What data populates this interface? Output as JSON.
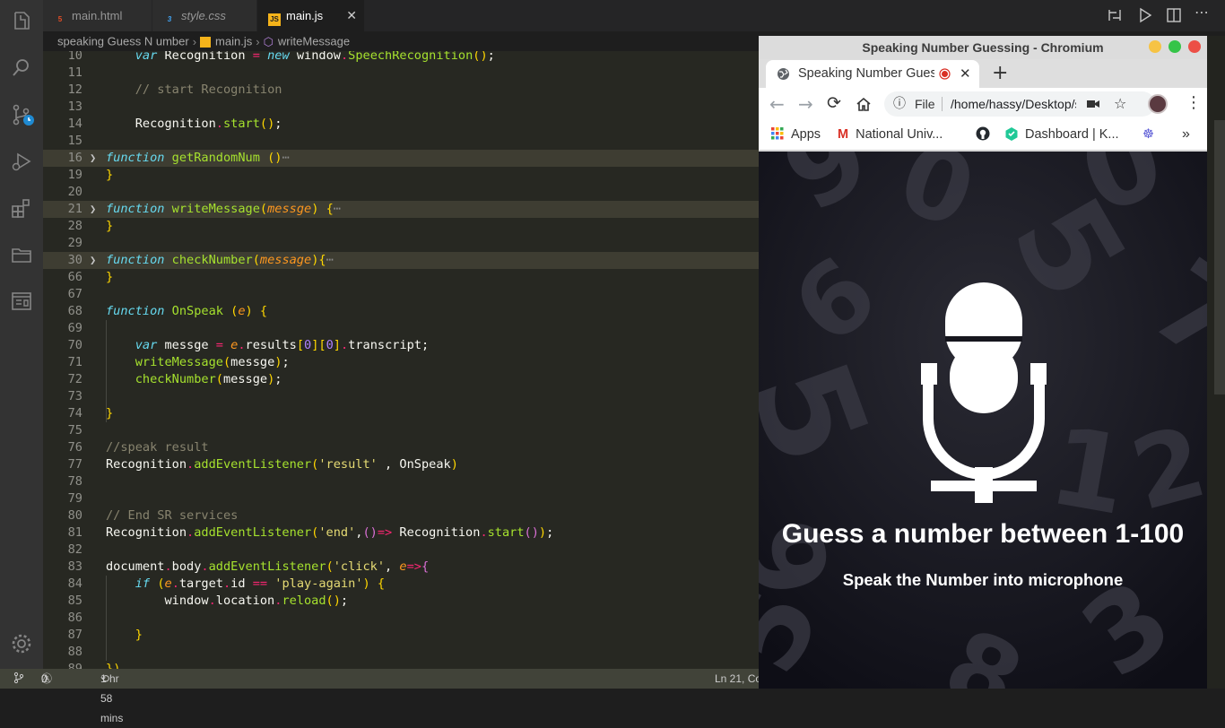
{
  "editor_tabs": [
    {
      "name": "main.html",
      "icon": "html5-icon",
      "active": false
    },
    {
      "name": "style.css",
      "icon": "css3-icon",
      "active": false
    },
    {
      "name": "main.js",
      "icon": "js-file-icon",
      "active": true
    }
  ],
  "breadcrumb": {
    "folder": "speaking Guess N umber",
    "file": "main.js",
    "symbol": "writeMessage"
  },
  "code_lines": [
    {
      "n": "10",
      "src": "    var Recognition = new window.SpeechRecognition();"
    },
    {
      "n": "11",
      "src": ""
    },
    {
      "n": "12",
      "src": "    // start Recognition"
    },
    {
      "n": "13",
      "src": ""
    },
    {
      "n": "14",
      "src": "    Recognition.start();"
    },
    {
      "n": "15",
      "src": ""
    },
    {
      "n": "16",
      "src": "function getRandomNum ()⋯",
      "folded": true
    },
    {
      "n": "19",
      "src": "}"
    },
    {
      "n": "20",
      "src": ""
    },
    {
      "n": "21",
      "src": "function writeMessage(messge) {⋯",
      "folded": true
    },
    {
      "n": "28",
      "src": "}"
    },
    {
      "n": "29",
      "src": ""
    },
    {
      "n": "30",
      "src": "function checkNumber(message){⋯",
      "folded": true
    },
    {
      "n": "66",
      "src": "}"
    },
    {
      "n": "67",
      "src": ""
    },
    {
      "n": "68",
      "src": "function OnSpeak (e) {"
    },
    {
      "n": "69",
      "src": ""
    },
    {
      "n": "70",
      "src": "    var messge = e.results[0][0].transcript;"
    },
    {
      "n": "71",
      "src": "    writeMessage(messge);"
    },
    {
      "n": "72",
      "src": "    checkNumber(messge);"
    },
    {
      "n": "73",
      "src": ""
    },
    {
      "n": "74",
      "src": "}"
    },
    {
      "n": "75",
      "src": ""
    },
    {
      "n": "76",
      "src": "//speak result"
    },
    {
      "n": "77",
      "src": "Recognition.addEventListener('result' , OnSpeak)"
    },
    {
      "n": "78",
      "src": ""
    },
    {
      "n": "79",
      "src": ""
    },
    {
      "n": "80",
      "src": "// End SR services"
    },
    {
      "n": "81",
      "src": "Recognition.addEventListener('end',()=> Recognition.start());"
    },
    {
      "n": "82",
      "src": ""
    },
    {
      "n": "83",
      "src": "document.body.addEventListener('click', e=>{"
    },
    {
      "n": "84",
      "src": "    if (e.target.id == 'play-again') {"
    },
    {
      "n": "85",
      "src": "        window.location.reload();"
    },
    {
      "n": "86",
      "src": ""
    },
    {
      "n": "87",
      "src": "    }"
    },
    {
      "n": "88",
      "src": ""
    },
    {
      "n": "89",
      "src": "})"
    }
  ],
  "statusbar": {
    "errors": "0",
    "warnings": "0",
    "time": "1 hr 58 mins",
    "position": "Ln 21, Co"
  },
  "browser": {
    "window_title": "Speaking Number Guessing - Chromium",
    "tab_title": "Speaking Number Guessing",
    "omnibox_scheme": "File",
    "omnibox_url": "/home/hassy/Desktop/speaking Guess N umber/main.html",
    "bookmarks": [
      "Apps",
      "National Univ...",
      "Dashboard | K..."
    ],
    "overflow": "»"
  },
  "page": {
    "title": "Guess a number between 1-100",
    "subtitle": "Speak the Number into microphone"
  },
  "colors": {
    "editor_bg": "#272822",
    "keyword": "#66d9ef",
    "function": "#a6e22e",
    "operator": "#f92672",
    "string": "#e6db74",
    "number": "#ae81ff",
    "comment": "#88846f",
    "statusbar_bg": "#414339"
  }
}
